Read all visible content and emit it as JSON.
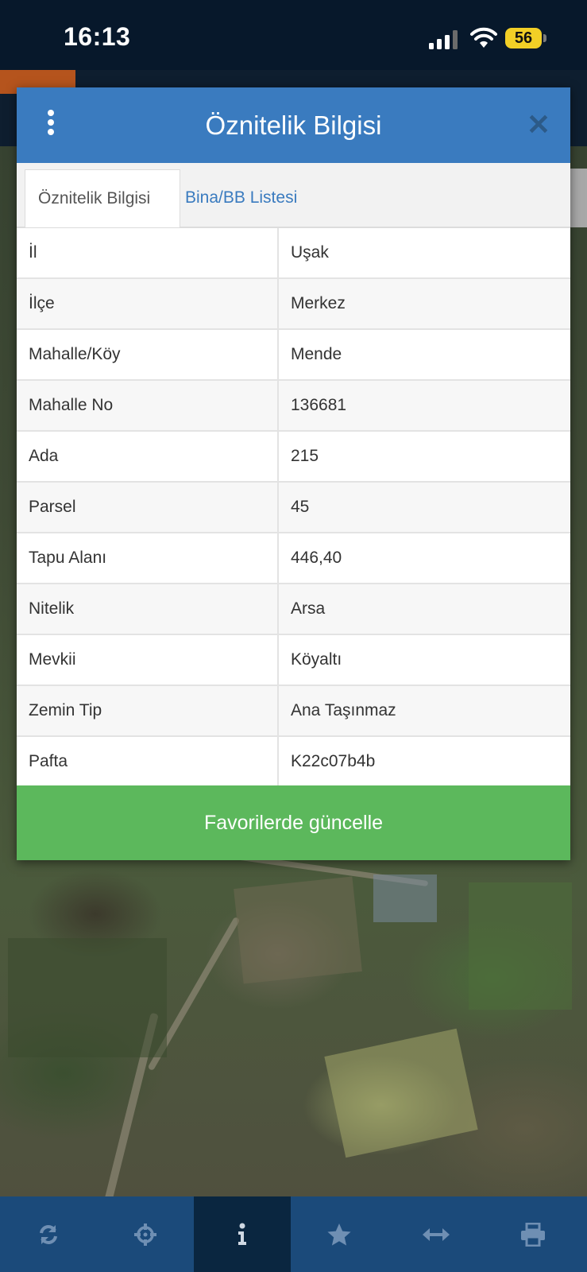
{
  "status_bar": {
    "time": "16:13",
    "battery": "56"
  },
  "dialog": {
    "title": "Öznitelik Bilgisi",
    "tabs": [
      {
        "label": "Öznitelik Bilgisi",
        "active": true
      },
      {
        "label": "Bina/BB Listesi",
        "active": false
      }
    ],
    "rows": [
      {
        "key": "İl",
        "value": "Uşak"
      },
      {
        "key": "İlçe",
        "value": "Merkez"
      },
      {
        "key": "Mahalle/Köy",
        "value": "Mende"
      },
      {
        "key": "Mahalle No",
        "value": "136681"
      },
      {
        "key": "Ada",
        "value": "215"
      },
      {
        "key": "Parsel",
        "value": "45"
      },
      {
        "key": "Tapu Alanı",
        "value": "446,40"
      },
      {
        "key": "Nitelik",
        "value": "Arsa"
      },
      {
        "key": "Mevkii",
        "value": "Köyaltı"
      },
      {
        "key": "Zemin Tip",
        "value": "Ana Taşınmaz"
      },
      {
        "key": "Pafta",
        "value": "K22c07b4b"
      }
    ],
    "update_button": "Favorilerde güncelle"
  },
  "toolbar": {
    "items": [
      {
        "icon": "refresh-icon",
        "active": false
      },
      {
        "icon": "crosshair-icon",
        "active": false
      },
      {
        "icon": "info-icon",
        "active": true
      },
      {
        "icon": "star-icon",
        "active": false
      },
      {
        "icon": "measure-arrows-icon",
        "active": false
      },
      {
        "icon": "print-icon",
        "active": false
      }
    ]
  },
  "colors": {
    "header_blue": "#3a7bbf",
    "button_green": "#5cb85c",
    "toolbar_blue": "#1b4a7a",
    "status_bar": "#07182b"
  }
}
